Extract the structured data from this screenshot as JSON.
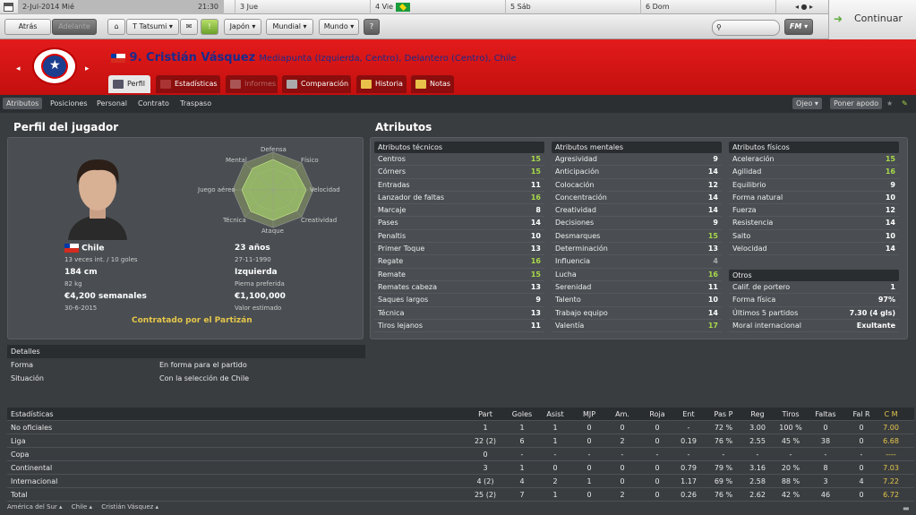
{
  "topbar": {
    "date": "2-Jul-2014 Mié",
    "time": "21:30",
    "d1": "3 Jue",
    "d2": "4 Vie",
    "d3": "5 Sáb",
    "d4": "6 Dom",
    "nav": "◂ ● ▸"
  },
  "nav": {
    "back": "Atrás",
    "fwd": "Adelante",
    "manager": "T Tatsumi ▾",
    "japan": "Japón ▾",
    "world": "Mundial ▾",
    "mundo": "Mundo ▾",
    "help": "?",
    "fm": "FM ▾",
    "continue": "Continuar"
  },
  "player": {
    "title": "9. Cristián Vásquez",
    "subtitle": "Mediapunta (Izquierda, Centro), Delantero (Centro), Chile"
  },
  "tabs": [
    "Perfil",
    "Estadísticas",
    "Informes",
    "Comparación",
    "Historia",
    "Notas"
  ],
  "subnav": {
    "items": [
      "Atributos",
      "Posiciones",
      "Personal",
      "Contrato",
      "Traspaso"
    ],
    "scout": "Ojeo ▾",
    "nickname": "Poner apodo"
  },
  "profile": {
    "heading": "Perfil del jugador",
    "radar": {
      "top": "Defensa",
      "tl": "Mental",
      "tr": "Físico",
      "l": "Juego aéreo",
      "r": "Velocidad",
      "bl": "Técnica",
      "br": "Creatividad",
      "b": "Ataque"
    },
    "nation": "Chile",
    "caps": "13 veces int. / 10 goles",
    "age": "23 años",
    "dob": "27-11-1990",
    "height": "184 cm",
    "weight": "82 kg",
    "foot": "Izquierda",
    "foot_label": "Pierna preferida",
    "wage": "€4,200 semanales",
    "wage_date": "30-6-2015",
    "value": "€1,100,000",
    "value_label": "Valor estimado",
    "contract": "Contratado por el Partizán"
  },
  "attributes": {
    "heading": "Atributos",
    "technical": {
      "title": "Atributos técnicos",
      "rows": [
        [
          "Centros",
          15
        ],
        [
          "Córners",
          15
        ],
        [
          "Entradas",
          11
        ],
        [
          "Lanzador de faltas",
          16
        ],
        [
          "Marcaje",
          8
        ],
        [
          "Pases",
          14
        ],
        [
          "Penaltis",
          10
        ],
        [
          "Primer Toque",
          13
        ],
        [
          "Regate",
          16
        ],
        [
          "Remate",
          15
        ],
        [
          "Remates cabeza",
          13
        ],
        [
          "Saques largos",
          9
        ],
        [
          "Técnica",
          13
        ],
        [
          "Tiros lejanos",
          11
        ]
      ]
    },
    "mental": {
      "title": "Atributos mentales",
      "rows": [
        [
          "Agresividad",
          9
        ],
        [
          "Anticipación",
          14
        ],
        [
          "Colocación",
          12
        ],
        [
          "Concentración",
          14
        ],
        [
          "Creatividad",
          14
        ],
        [
          "Decisiones",
          9
        ],
        [
          "Desmarques",
          15
        ],
        [
          "Determinación",
          13
        ],
        [
          "Influencia",
          4
        ],
        [
          "Lucha",
          16
        ],
        [
          "Serenidad",
          11
        ],
        [
          "Talento",
          10
        ],
        [
          "Trabajo equipo",
          14
        ],
        [
          "Valentía",
          17
        ]
      ]
    },
    "physical": {
      "title": "Atributos físicos",
      "rows": [
        [
          "Aceleración",
          15
        ],
        [
          "Agilidad",
          16
        ],
        [
          "Equilibrio",
          9
        ],
        [
          "Forma natural",
          10
        ],
        [
          "Fuerza",
          12
        ],
        [
          "Resistencia",
          14
        ],
        [
          "Salto",
          10
        ],
        [
          "Velocidad",
          14
        ]
      ]
    },
    "others": {
      "title": "Otros",
      "rows": [
        [
          "Calif. de portero",
          "1"
        ],
        [
          "Forma física",
          "97%"
        ],
        [
          "Últimos 5 partidos",
          "7.30 (4 gls)"
        ],
        [
          "Moral internacional",
          "Exultante"
        ]
      ]
    }
  },
  "details": {
    "title": "Detalles",
    "rows": [
      [
        "Forma",
        "En forma para el partido"
      ],
      [
        "Situación",
        "Con la selección de Chile"
      ]
    ]
  },
  "stats": {
    "headers": [
      "Estadísticas",
      "Part",
      "Goles",
      "Asist",
      "MJP",
      "Am.",
      "Roja",
      "Ent",
      "Pas P",
      "Reg",
      "Tiros",
      "Faltas",
      "Fal R",
      "C M"
    ],
    "rows": [
      [
        "No oficiales",
        "1",
        "1",
        "1",
        "0",
        "0",
        "0",
        "-",
        "72 %",
        "3.00",
        "100 %",
        "0",
        "0",
        "7.00"
      ],
      [
        "Liga",
        "22 (2)",
        "6",
        "1",
        "0",
        "2",
        "0",
        "0.19",
        "76 %",
        "2.55",
        "45 %",
        "38",
        "0",
        "6.68"
      ],
      [
        "Copa",
        "0",
        "-",
        "-",
        "-",
        "-",
        "-",
        "-",
        "-",
        "-",
        "-",
        "-",
        "-",
        "----"
      ],
      [
        "Continental",
        "3",
        "1",
        "0",
        "0",
        "0",
        "0",
        "0.79",
        "79 %",
        "3.16",
        "20 %",
        "8",
        "0",
        "7.03"
      ],
      [
        "Internacional",
        "4 (2)",
        "4",
        "2",
        "1",
        "0",
        "0",
        "1.17",
        "69 %",
        "2.58",
        "88 %",
        "3",
        "4",
        "7.22"
      ],
      [
        "Total",
        "25 (2)",
        "7",
        "1",
        "0",
        "2",
        "0",
        "0.26",
        "76 %",
        "2.62",
        "42 %",
        "46",
        "0",
        "6.72"
      ]
    ]
  },
  "footer": {
    "b1": "América del Sur ▴",
    "b2": "Chile ▴",
    "b3": "Cristián Vásquez ▴"
  }
}
